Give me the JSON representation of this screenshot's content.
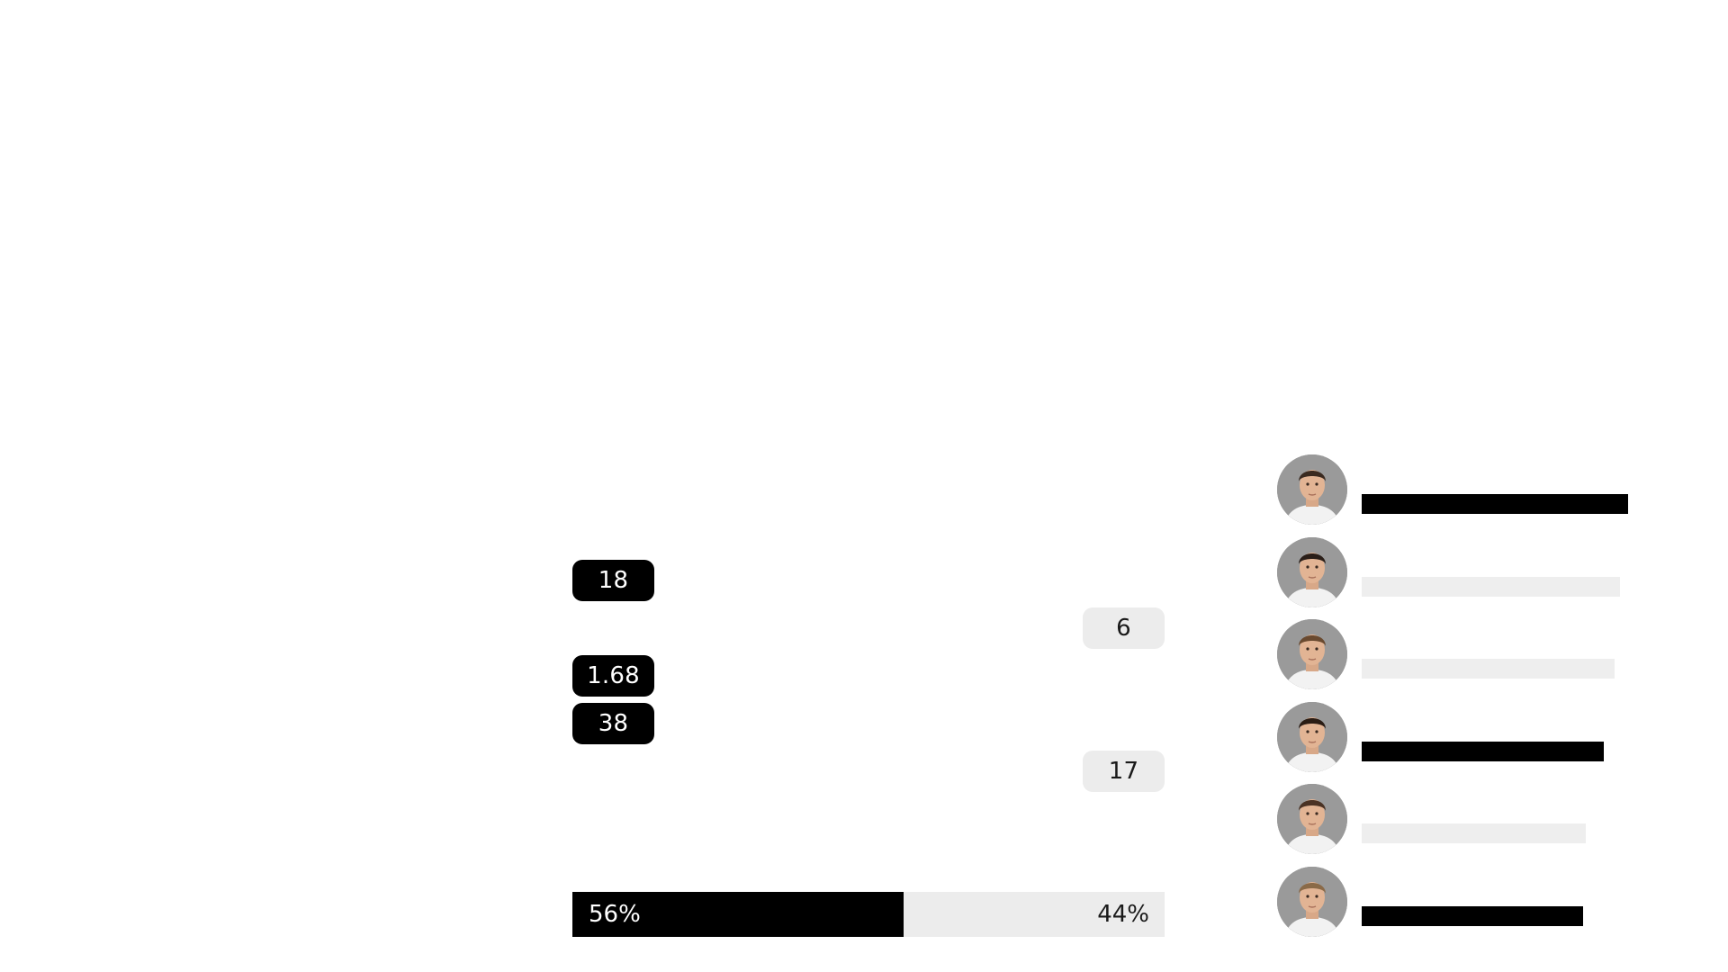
{
  "stats_left": [
    {
      "value": "18"
    },
    {
      "value": "1.68"
    },
    {
      "value": "38"
    }
  ],
  "stats_right": [
    {
      "value": "6"
    },
    {
      "value": "17"
    }
  ],
  "possession": {
    "home_label": "56%",
    "away_label": "44%",
    "home_fraction": 0.56,
    "away_fraction": 0.44
  },
  "players": [
    {
      "avatar_icon": "player-portrait-icon",
      "bar_level": 1.0,
      "bar_tone": "dark",
      "hair_color": "#3a2a20"
    },
    {
      "avatar_icon": "player-portrait-icon",
      "bar_level": 0.97,
      "bar_tone": "light",
      "hair_color": "#2a1e18"
    },
    {
      "avatar_icon": "player-portrait-icon",
      "bar_level": 0.95,
      "bar_tone": "light",
      "hair_color": "#6a4a30"
    },
    {
      "avatar_icon": "player-portrait-icon",
      "bar_level": 0.91,
      "bar_tone": "dark",
      "hair_color": "#2a1c14"
    },
    {
      "avatar_icon": "player-portrait-icon",
      "bar_level": 0.84,
      "bar_tone": "light",
      "hair_color": "#4a3224"
    },
    {
      "avatar_icon": "player-portrait-icon",
      "bar_level": 0.83,
      "bar_tone": "dark",
      "hair_color": "#8a6a48"
    }
  ],
  "colors": {
    "dark": "#000000",
    "light": "#ececec",
    "avatar_bg": "#9a9a9a"
  }
}
